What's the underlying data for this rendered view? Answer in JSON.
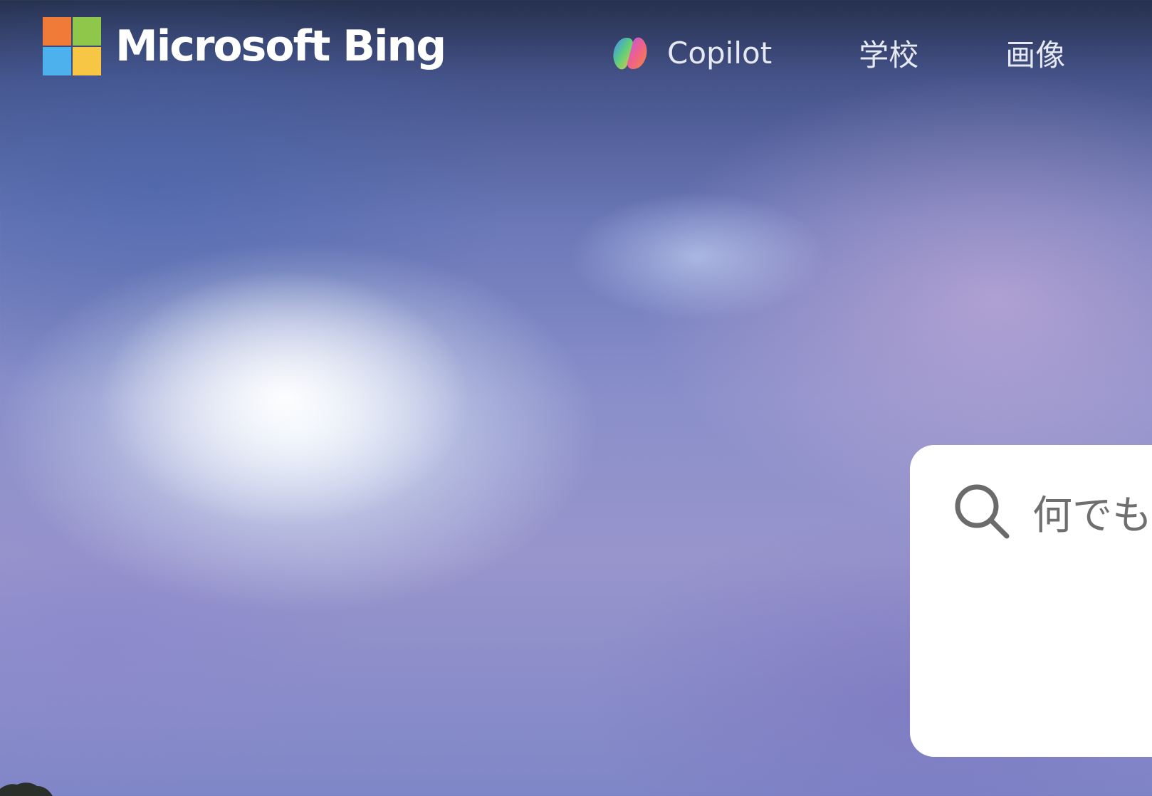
{
  "header": {
    "brand": "Microsoft Bing",
    "nav": {
      "copilot_label": "Copilot",
      "school_label": "学校",
      "images_label": "画像"
    }
  },
  "search": {
    "placeholder": "何でも"
  },
  "icons": {
    "logo": "microsoft-logo-icon",
    "copilot": "copilot-icon",
    "search": "search-icon"
  },
  "colors": {
    "ms_red": "#f07a38",
    "ms_green": "#8fc74a",
    "ms_blue": "#4cb1ec",
    "ms_yellow": "#f7c644",
    "nav_text": "#e6e8f2",
    "search_bg": "#ffffff",
    "placeholder_text": "#6f6f6f"
  }
}
